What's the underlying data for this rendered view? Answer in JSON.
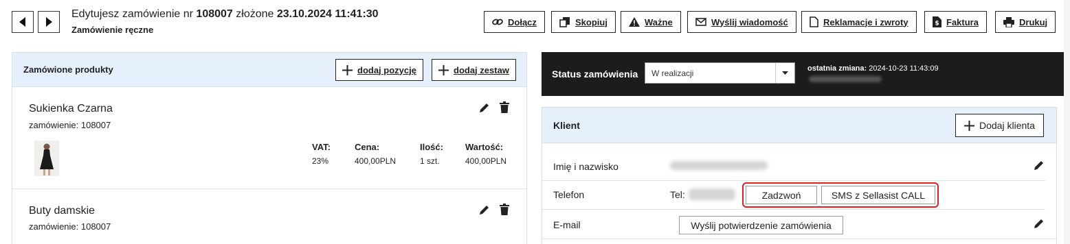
{
  "header": {
    "title_prefix": "Edytujesz zamówienie nr",
    "order_number": "108007",
    "title_middle": "złożone",
    "order_datetime": "23.10.2024 11:41:30",
    "subtitle": "Zamówienie ręczne"
  },
  "toolbar": {
    "attach": "Dołącz",
    "copy": "Skopiuj",
    "important": "Ważne",
    "send_message": "Wyślij wiadomość",
    "returns": "Reklamacje i zwroty",
    "invoice": "Faktura",
    "print": "Drukuj"
  },
  "products_panel": {
    "title": "Zamówione produkty",
    "add_item": "dodaj pozycję",
    "add_set": "dodaj zestaw",
    "columns": {
      "vat": "VAT:",
      "price": "Cena:",
      "qty": "Ilość:",
      "value": "Wartość:"
    },
    "items": [
      {
        "name": "Sukienka Czarna",
        "order": "zamówienie: 108007",
        "vat": "23%",
        "price": "400,00PLN",
        "qty": "1 szt.",
        "value": "400,00PLN"
      },
      {
        "name": "Buty damskie",
        "order": "zamówienie: 108007"
      }
    ]
  },
  "status": {
    "label": "Status zamówienia",
    "selected": "W realizacji",
    "last_change_label": "ostatnia zmiana:",
    "last_change_value": "2024-10-23 11:43:09"
  },
  "client": {
    "title": "Klient",
    "add_client": "Dodaj klienta",
    "name_label": "Imię i nazwisko",
    "phone_label": "Telefon",
    "phone_prefix": "Tel:",
    "call_button": "Zadzwoń",
    "sms_button": "SMS z Sellasist CALL",
    "email_label": "E-mail",
    "send_confirmation": "Wyślij potwierdzenie zamówienia"
  },
  "colors": {
    "header_bg": "#e6f0fc",
    "status_bg": "#1c1c1c",
    "highlight": "#e02020"
  }
}
